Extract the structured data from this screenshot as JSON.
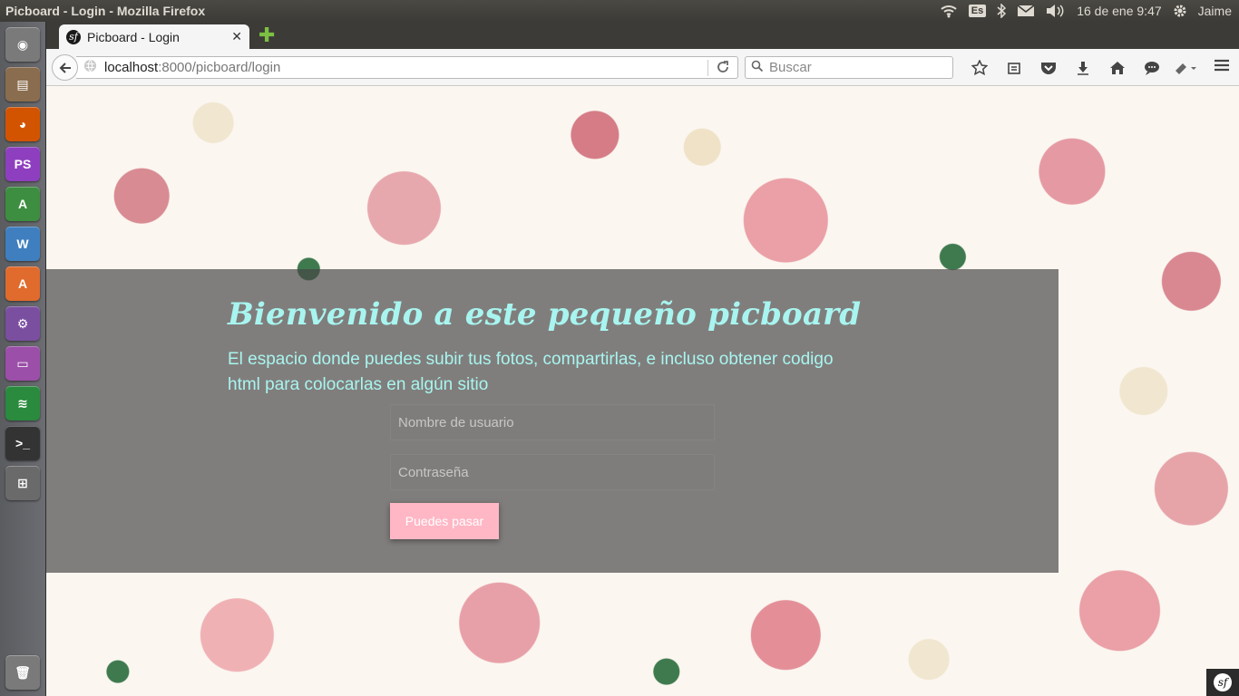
{
  "system": {
    "window_title": "Picboard - Login - Mozilla Firefox",
    "keyboard_layout": "Es",
    "datetime": "16 de ene  9:47",
    "user": "Jaime"
  },
  "launcher": {
    "items": [
      {
        "name": "ubuntu-dash",
        "glyph": "◉",
        "color": "#7a7a7a"
      },
      {
        "name": "files",
        "glyph": "▤",
        "color": "#8a6d4e"
      },
      {
        "name": "firefox",
        "glyph": "◕",
        "color": "#d35400"
      },
      {
        "name": "phpstorm",
        "glyph": "PS",
        "color": "#8e3fbf"
      },
      {
        "name": "android-studio",
        "glyph": "A",
        "color": "#3e8e41"
      },
      {
        "name": "mysql-workbench",
        "glyph": "W",
        "color": "#3f7fbf"
      },
      {
        "name": "software-center",
        "glyph": "A",
        "color": "#e06b2c"
      },
      {
        "name": "system-settings",
        "glyph": "⚙",
        "color": "#7a4fa0"
      },
      {
        "name": "app-window",
        "glyph": "▭",
        "color": "#9b4fa8"
      },
      {
        "name": "spotify",
        "glyph": "≋",
        "color": "#2a8a3e"
      },
      {
        "name": "terminal",
        "glyph": ">_",
        "color": "#333333"
      },
      {
        "name": "workspaces",
        "glyph": "⊞",
        "color": "#6a6a6a"
      },
      {
        "name": "trash",
        "glyph": "🗑",
        "color": "#7a7a7a"
      }
    ]
  },
  "browser": {
    "tab_title": "Picboard - Login",
    "url_host": "localhost",
    "url_path": ":8000/picboard/login",
    "search_placeholder": "Buscar"
  },
  "page": {
    "title": "Bienvenido a este pequeño picboard",
    "subtitle": "El espacio donde puedes subir tus fotos, compartirlas, e incluso obtener codigo html para colocarlas en algún sitio",
    "username_placeholder": "Nombre de usuario",
    "password_placeholder": "Contraseña",
    "submit_label": "Puedes pasar",
    "colors": {
      "title": "#a8f5f0",
      "button": "#ffb7c5",
      "overlay": "#464646"
    }
  }
}
